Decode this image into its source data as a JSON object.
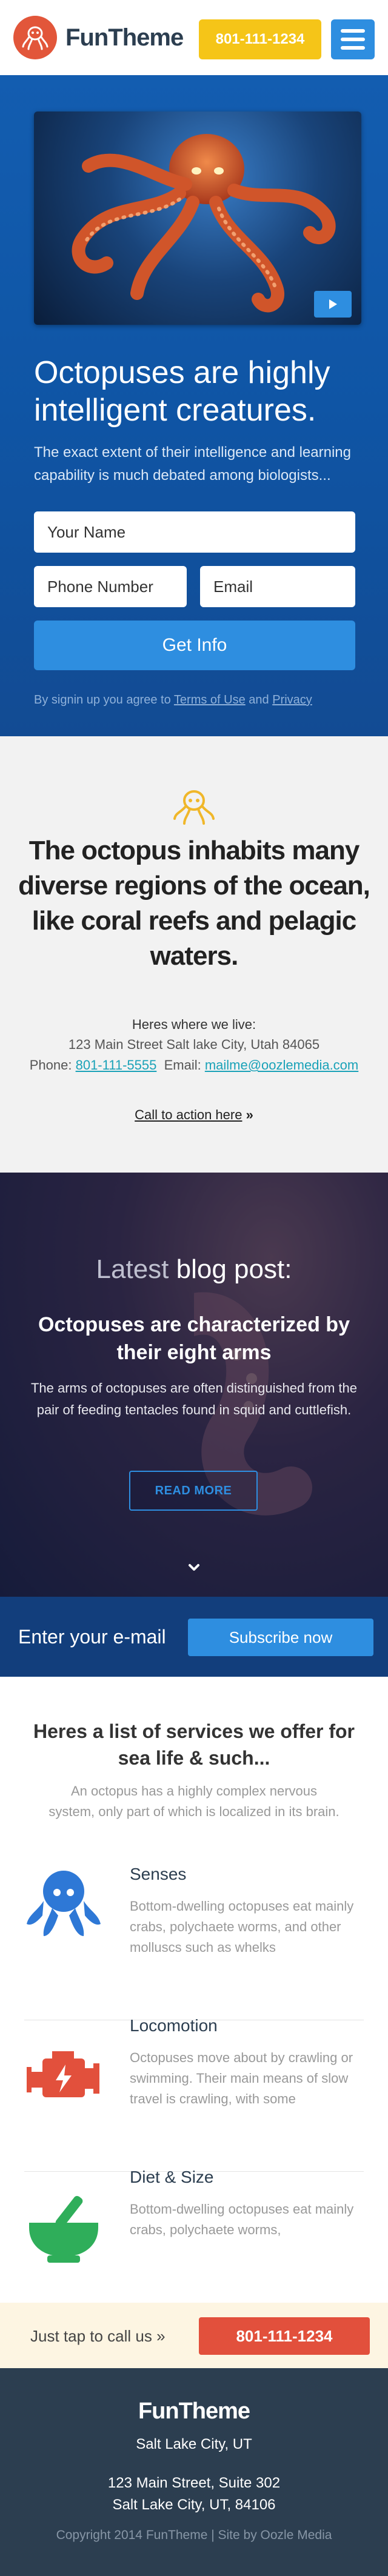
{
  "header": {
    "brand": "FunTheme",
    "phone": "801-111-1234"
  },
  "hero": {
    "title": "Octopuses are highly intelligent creatures.",
    "subtitle": "The exact extent of their intelligence and learning capability is much debated among biologists...",
    "name_placeholder": "Your Name",
    "phone_placeholder": "Phone Number",
    "email_placeholder": "Email",
    "submit_label": "Get Info",
    "terms_prefix": "By signin up you agree to",
    "terms_link": "Terms of Use",
    "terms_and": "and",
    "privacy_link": "Privacy"
  },
  "info": {
    "title": "The octopus inhabits many diverse regions of the ocean, like coral reefs and pelagic waters.",
    "live_label": "Heres where we live:",
    "address": "123 Main Street Salt lake City, Utah 84065",
    "phone_label": "Phone:",
    "phone": "801-111-5555",
    "email_label": "Email:",
    "email": "mailme@oozlemedia.com",
    "cta": "Call to action here",
    "cta_suffix": "»"
  },
  "blog": {
    "heading_light": "Latest",
    "heading_strong": "blog post:",
    "post_title": "Octopuses are characterized by their eight arms",
    "post_excerpt": "The arms of octopuses are often distinguished from the pair of feeding tentacles found in squid and cuttlefish.",
    "read_more": "READ MORE"
  },
  "subscribe": {
    "label": "Enter your e-mail",
    "button": "Subscribe now"
  },
  "services": {
    "title": "Heres a list of services we offer for sea life & such...",
    "intro": "An octopus has a highly complex nervous system, only part of which is localized in its brain.",
    "items": [
      {
        "name": "Senses",
        "desc": "Bottom-dwelling octopuses eat mainly crabs, polychaete worms, and other molluscs such as whelks",
        "icon": "octopus-icon",
        "color": "#2e78d6"
      },
      {
        "name": "Locomotion",
        "desc": "Octopuses move about by crawling or swimming. Their main means of slow travel is crawling, with some",
        "icon": "engine-icon",
        "color": "#e2503c"
      },
      {
        "name": "Diet & Size",
        "desc": "Bottom-dwelling octopuses eat mainly crabs, polychaete worms,",
        "icon": "mortar-pestle-icon",
        "color": "#2fae5a"
      }
    ]
  },
  "callbar": {
    "label": "Just tap to call us »",
    "phone": "801-111-1234"
  },
  "footer": {
    "brand": "FunTheme",
    "city": "Salt Lake City, UT",
    "address_line1": "123 Main Street, Suite 302",
    "address_line2": "Salt Lake City, UT, 84106",
    "copyright": "Copyright 2014 FunTheme | Site by Oozle Media"
  },
  "colors": {
    "accent_blue": "#2e8ee0",
    "accent_yellow": "#f5c518",
    "accent_red": "#e2503c",
    "brand_orange": "#e2563a",
    "hero_blue": "#135db0",
    "footer_dark": "#2c3e50"
  }
}
